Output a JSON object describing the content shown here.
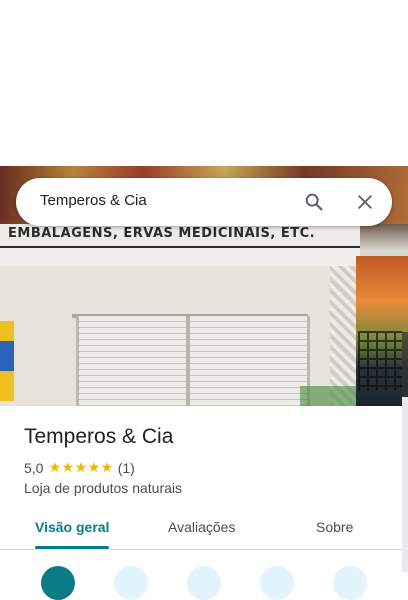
{
  "search": {
    "value": "Temperos & Cia"
  },
  "photo": {
    "sign_text": "EMBALAGENS, ERVAS MEDICINAIS, ETC."
  },
  "place": {
    "name": "Temperos & Cia",
    "rating": "5,0",
    "stars": "★★★★★",
    "review_count": "(1)",
    "category": "Loja de produtos naturais"
  },
  "tabs": [
    {
      "label": "Visão geral",
      "active": true
    },
    {
      "label": "Avaliações",
      "active": false
    },
    {
      "label": "Sobre",
      "active": false
    }
  ],
  "colors": {
    "accent": "#0b7c86",
    "star": "#f4b400",
    "action_bg": "#e1f4fb"
  },
  "icons": {
    "search": "search-icon",
    "close": "close-icon"
  }
}
